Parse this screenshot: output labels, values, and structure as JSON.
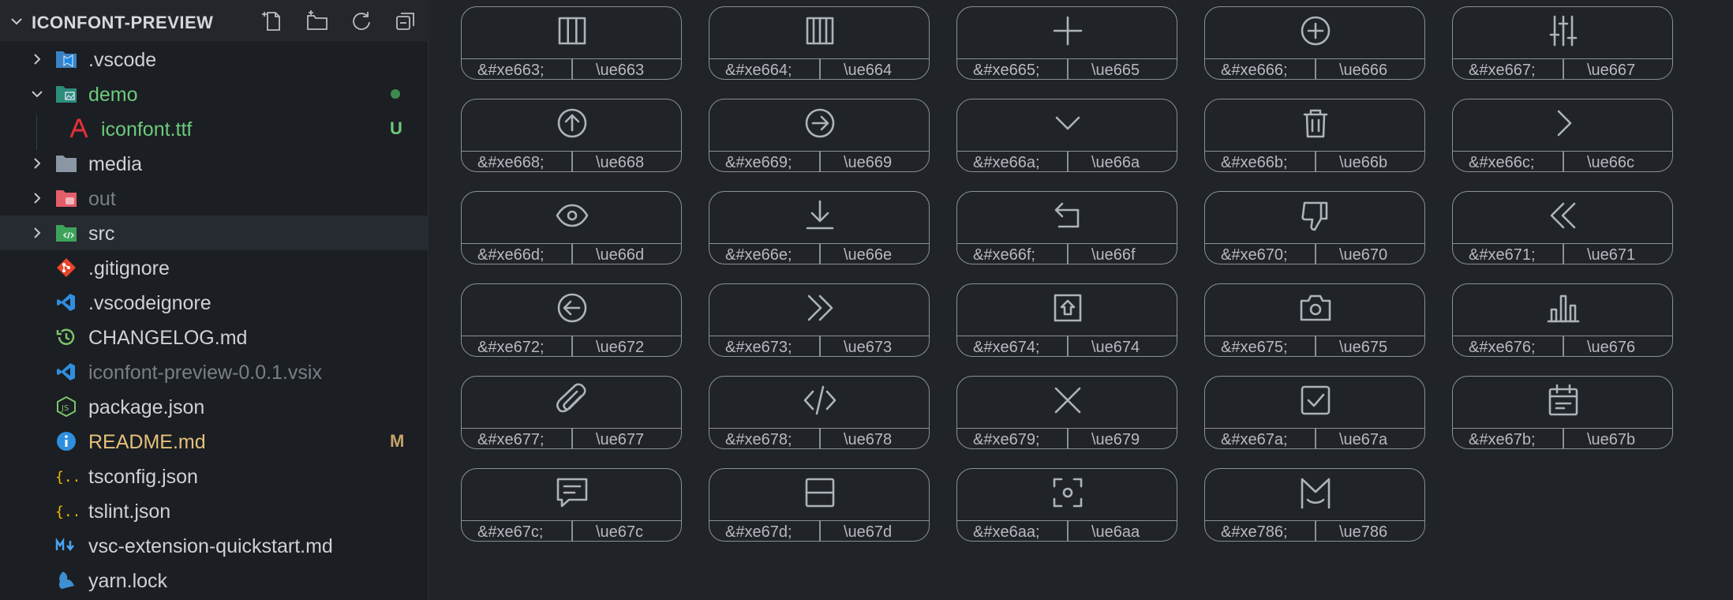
{
  "sidebar": {
    "title": "ICONFONT-PREVIEW",
    "actions": [
      "new-file-icon",
      "new-folder-icon",
      "refresh-icon",
      "collapse-all-icon"
    ],
    "items": [
      {
        "label": ".vscode",
        "kind": "folder",
        "icon": "vscode-folder-icon",
        "expanded": false,
        "depth": 0
      },
      {
        "label": "demo",
        "kind": "folder",
        "icon": "demo-folder-icon",
        "expanded": true,
        "depth": 0,
        "status": "dot"
      },
      {
        "label": "iconfont.ttf",
        "kind": "file",
        "icon": "font-file-icon",
        "depth": 1,
        "badge": "U"
      },
      {
        "label": "media",
        "kind": "folder",
        "icon": "folder-icon",
        "expanded": false,
        "depth": 0
      },
      {
        "label": "out",
        "kind": "folder",
        "icon": "out-folder-icon",
        "expanded": false,
        "depth": 0
      },
      {
        "label": "src",
        "kind": "folder",
        "icon": "src-folder-icon",
        "expanded": false,
        "depth": 0,
        "selected": true
      },
      {
        "label": ".gitignore",
        "kind": "file",
        "icon": "git-icon",
        "depth": 0
      },
      {
        "label": ".vscodeignore",
        "kind": "file",
        "icon": "vscode-icon",
        "depth": 0
      },
      {
        "label": "CHANGELOG.md",
        "kind": "file",
        "icon": "changelog-icon",
        "depth": 0
      },
      {
        "label": "iconfont-preview-0.0.1.vsix",
        "kind": "file",
        "icon": "vscode-icon",
        "depth": 0
      },
      {
        "label": "package.json",
        "kind": "file",
        "icon": "nodejs-icon",
        "depth": 0
      },
      {
        "label": "README.md",
        "kind": "file",
        "icon": "info-icon",
        "depth": 0,
        "badge": "M"
      },
      {
        "label": "tsconfig.json",
        "kind": "file",
        "icon": "json-icon",
        "depth": 0
      },
      {
        "label": "tslint.json",
        "kind": "file",
        "icon": "json-icon",
        "depth": 0
      },
      {
        "label": "vsc-extension-quickstart.md",
        "kind": "file",
        "icon": "markdown-icon",
        "depth": 0
      },
      {
        "label": "yarn.lock",
        "kind": "file",
        "icon": "yarn-icon",
        "depth": 0
      }
    ]
  },
  "colors": {
    "sidebar_bg": "#1b1e22",
    "editor_bg": "#202328",
    "card_border": "#8b9098",
    "icon_stroke": "#aeb3ba",
    "text": "#cfd1d4",
    "git_untracked": "#6ccb7b",
    "git_modified": "#e5c07b"
  },
  "icons": [
    {
      "entity": "&#xe663;",
      "code": "\\ue663",
      "name": "columns-3-icon"
    },
    {
      "entity": "&#xe664;",
      "code": "\\ue664",
      "name": "columns-4-icon"
    },
    {
      "entity": "&#xe665;",
      "code": "\\ue665",
      "name": "plus-icon"
    },
    {
      "entity": "&#xe666;",
      "code": "\\ue666",
      "name": "plus-circle-icon"
    },
    {
      "entity": "&#xe667;",
      "code": "\\ue667",
      "name": "sliders-icon"
    },
    {
      "entity": "&#xe668;",
      "code": "\\ue668",
      "name": "arrow-up-circle-icon"
    },
    {
      "entity": "&#xe669;",
      "code": "\\ue669",
      "name": "arrow-right-circle-icon"
    },
    {
      "entity": "&#xe66a;",
      "code": "\\ue66a",
      "name": "chevron-down-icon"
    },
    {
      "entity": "&#xe66b;",
      "code": "\\ue66b",
      "name": "trash-icon"
    },
    {
      "entity": "&#xe66c;",
      "code": "\\ue66c",
      "name": "chevron-right-icon"
    },
    {
      "entity": "&#xe66d;",
      "code": "\\ue66d",
      "name": "eye-icon"
    },
    {
      "entity": "&#xe66e;",
      "code": "\\ue66e",
      "name": "download-icon"
    },
    {
      "entity": "&#xe66f;",
      "code": "\\ue66f",
      "name": "return-icon"
    },
    {
      "entity": "&#xe670;",
      "code": "\\ue670",
      "name": "thumbs-down-icon"
    },
    {
      "entity": "&#xe671;",
      "code": "\\ue671",
      "name": "chevrons-left-icon"
    },
    {
      "entity": "&#xe672;",
      "code": "\\ue672",
      "name": "arrow-left-circle-icon"
    },
    {
      "entity": "&#xe673;",
      "code": "\\ue673",
      "name": "chevrons-right-icon"
    },
    {
      "entity": "&#xe674;",
      "code": "\\ue674",
      "name": "upload-box-icon"
    },
    {
      "entity": "&#xe675;",
      "code": "\\ue675",
      "name": "camera-icon"
    },
    {
      "entity": "&#xe676;",
      "code": "\\ue676",
      "name": "bar-chart-icon"
    },
    {
      "entity": "&#xe677;",
      "code": "\\ue677",
      "name": "paperclip-icon"
    },
    {
      "entity": "&#xe678;",
      "code": "\\ue678",
      "name": "code-icon"
    },
    {
      "entity": "&#xe679;",
      "code": "\\ue679",
      "name": "close-icon"
    },
    {
      "entity": "&#xe67a;",
      "code": "\\ue67a",
      "name": "checkbox-icon"
    },
    {
      "entity": "&#xe67b;",
      "code": "\\ue67b",
      "name": "calendar-icon"
    },
    {
      "entity": "&#xe67c;",
      "code": "\\ue67c",
      "name": "message-icon"
    },
    {
      "entity": "&#xe67d;",
      "code": "\\ue67d",
      "name": "split-horizontal-icon"
    },
    {
      "entity": "&#xe6aa;",
      "code": "\\ue6aa",
      "name": "scan-icon"
    },
    {
      "entity": "&#xe786;",
      "code": "\\ue786",
      "name": "m-logo-icon"
    }
  ]
}
